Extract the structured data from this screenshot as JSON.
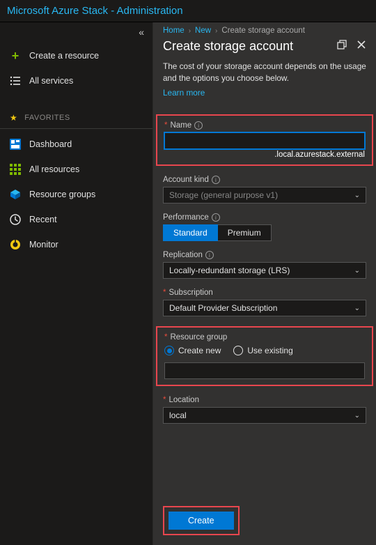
{
  "header": {
    "title": "Microsoft Azure Stack - Administration"
  },
  "sidebar": {
    "collapse_glyph": "«",
    "create_resource": "Create a resource",
    "all_services": "All services",
    "favorites_label": "FAVORITES",
    "items": [
      {
        "label": "Dashboard"
      },
      {
        "label": "All resources"
      },
      {
        "label": "Resource groups"
      },
      {
        "label": "Recent"
      },
      {
        "label": "Monitor"
      }
    ]
  },
  "breadcrumb": {
    "home": "Home",
    "new": "New",
    "current": "Create storage account"
  },
  "blade": {
    "title": "Create storage account",
    "desc": "The cost of your storage account depends on the usage and the options you choose below.",
    "learn_more": "Learn more"
  },
  "form": {
    "name": {
      "label": "Name",
      "value": "",
      "suffix": ".local.azurestack.external"
    },
    "account_kind": {
      "label": "Account kind",
      "value": "Storage (general purpose v1)"
    },
    "performance": {
      "label": "Performance",
      "options": [
        "Standard",
        "Premium"
      ],
      "selected": "Standard"
    },
    "replication": {
      "label": "Replication",
      "value": "Locally-redundant storage (LRS)"
    },
    "subscription": {
      "label": "Subscription",
      "value": "Default Provider Subscription"
    },
    "resource_group": {
      "label": "Resource group",
      "create_new": "Create new",
      "use_existing": "Use existing",
      "selected": "create_new",
      "value": ""
    },
    "location": {
      "label": "Location",
      "value": "local"
    }
  },
  "footer": {
    "create": "Create"
  }
}
